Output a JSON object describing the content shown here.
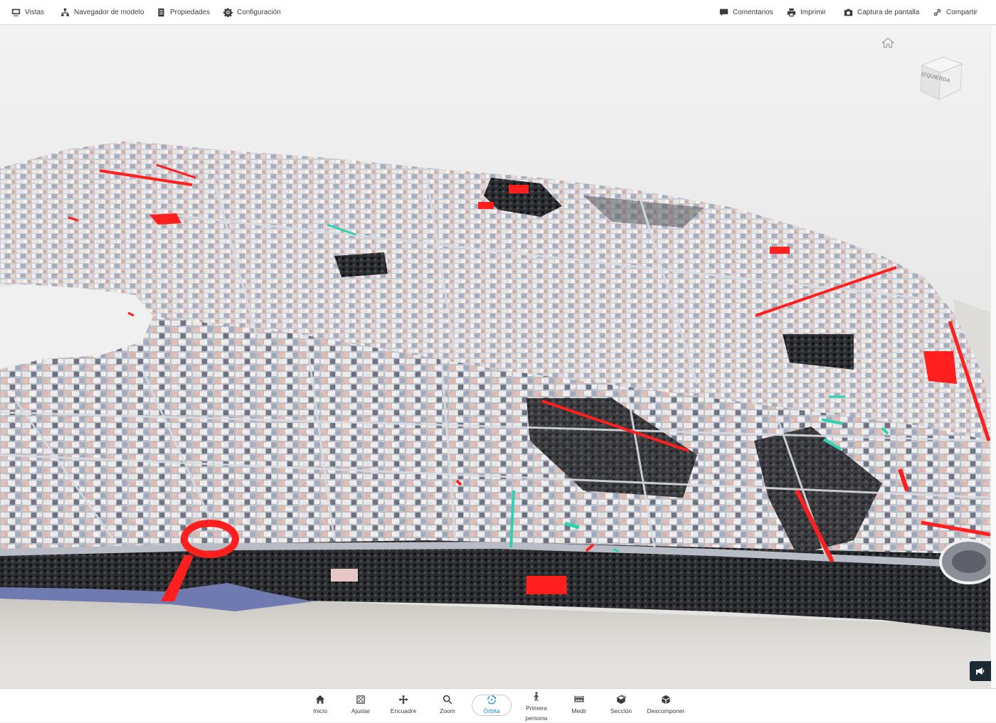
{
  "topbar": {
    "left": [
      {
        "label": "Vistas",
        "icon": "monitor-icon"
      },
      {
        "label": "Navegador de modelo",
        "icon": "hierarchy-icon"
      },
      {
        "label": "Propiedades",
        "icon": "properties-icon"
      },
      {
        "label": "Configuración",
        "icon": "gear-icon"
      }
    ],
    "right": [
      {
        "label": "Comentarios",
        "icon": "comment-icon"
      },
      {
        "label": "Imprimir",
        "icon": "printer-icon"
      },
      {
        "label": "Captura de pantalla",
        "icon": "camera-icon"
      },
      {
        "label": "Compartir",
        "icon": "share-link-icon"
      }
    ]
  },
  "viewcube": {
    "face_label": "IZQUIERDA"
  },
  "bottombar": {
    "items": [
      {
        "label": "Inicio",
        "icon": "home-icon"
      },
      {
        "label": "Ajustar",
        "icon": "fit-icon"
      },
      {
        "label": "Encuadre",
        "icon": "pan-icon"
      },
      {
        "label": "Zoom",
        "icon": "zoom-icon"
      },
      {
        "label": "Órbita",
        "icon": "orbit-icon",
        "active": true
      },
      {
        "label": "Primera persona",
        "icon": "walk-icon"
      },
      {
        "label": "Medir",
        "icon": "measure-icon"
      },
      {
        "label": "Sección",
        "icon": "section-icon"
      },
      {
        "label": "Descomponer",
        "icon": "explode-icon"
      }
    ]
  },
  "colors": {
    "accent": "#1a8fd6",
    "highlight_red": "#ff1f1f",
    "highlight_teal": "#2ed3b0",
    "water": "#6f7bb0"
  }
}
